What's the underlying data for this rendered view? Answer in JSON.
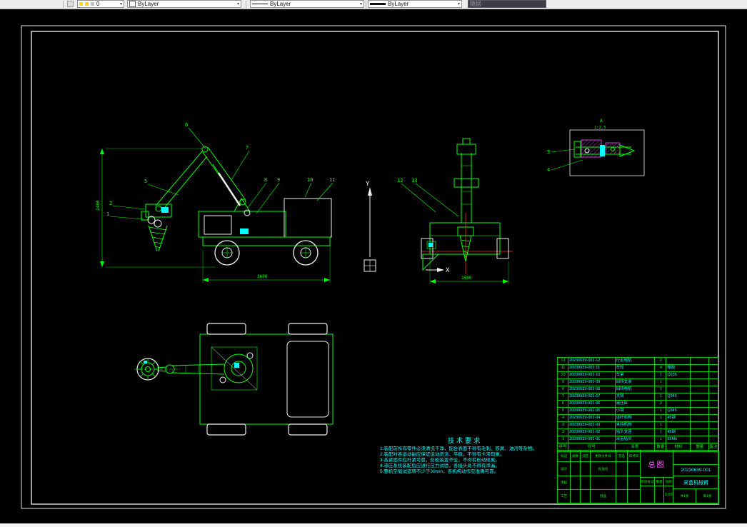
{
  "toolbar": {
    "layer": "0",
    "color": "ByLayer",
    "linetype": "ByLayer",
    "lineweight": "ByLayer",
    "plotstyle": "随层"
  },
  "drawing": {
    "side_callouts": [
      "1",
      "2",
      "5",
      "6",
      "7",
      "8",
      "9",
      "10",
      "11"
    ],
    "front_callouts": [
      "12",
      "13"
    ],
    "detail_callouts": [
      "3",
      "4"
    ],
    "detail_label": "A",
    "detail_scale": "1:2.5",
    "dims": {
      "side_height": "2400",
      "side_length": "3600",
      "front_width": "1500"
    },
    "ucs": {
      "x": "X",
      "y": "Y"
    }
  },
  "tech_notes": {
    "title": "技术要求",
    "lines": [
      "1.装配前所有零件必须清洗干净，配合表面不得有毛刺、铁屑、油污等杂物。",
      "2.装配时各运动副应保证运动灵活、平稳，不得有卡滞现象。",
      "3.各紧固件应拧紧可靠，防松装置齐全，不得有松动现象。",
      "4.液压系统装配后应进行压力试验，各接头处不得有渗漏。",
      "5.整机空载试运转不少于30min，各机构动作应准确可靠。"
    ]
  },
  "bom": {
    "headers": {
      "idx": "序号",
      "code": "代号",
      "name": "名称",
      "qty": "数量",
      "material": "材料",
      "weight": "重量",
      "note": "备注"
    },
    "rows": [
      {
        "idx": "12",
        "code": "20230639-001-12",
        "name": "行走电机",
        "qty": "2",
        "material": "",
        "weight": "",
        "note": ""
      },
      {
        "idx": "11",
        "code": "20230639-001-11",
        "name": "车轮",
        "qty": "4",
        "material": "橡胶",
        "weight": "",
        "note": ""
      },
      {
        "idx": "10",
        "code": "20230639-001-10",
        "name": "车架",
        "qty": "1",
        "material": "Q235",
        "weight": "",
        "note": ""
      },
      {
        "idx": "9",
        "code": "20230639-001-09",
        "name": "回转支承",
        "qty": "1",
        "material": "",
        "weight": "",
        "note": ""
      },
      {
        "idx": "8",
        "code": "20230639-001-08",
        "name": "回转电机",
        "qty": "1",
        "material": "",
        "weight": "",
        "note": ""
      },
      {
        "idx": "7",
        "code": "20230639-001-07",
        "name": "大臂",
        "qty": "1",
        "material": "Q345",
        "weight": "",
        "note": ""
      },
      {
        "idx": "6",
        "code": "20230639-001-06",
        "name": "液压缸",
        "qty": "2",
        "material": "",
        "weight": "",
        "note": ""
      },
      {
        "idx": "5",
        "code": "20230639-001-05",
        "name": "小臂",
        "qty": "1",
        "material": "Q345",
        "weight": "",
        "note": ""
      },
      {
        "idx": "4",
        "code": "20230639-001-04",
        "name": "连杆机构",
        "qty": "1",
        "material": "45钢",
        "weight": "",
        "note": ""
      },
      {
        "idx": "3",
        "code": "20230639-001-03",
        "name": "夹持机构",
        "qty": "1",
        "material": "",
        "weight": "",
        "note": ""
      },
      {
        "idx": "2",
        "code": "20230639-001-02",
        "name": "钻头支座",
        "qty": "1",
        "material": "45钢",
        "weight": "",
        "note": ""
      },
      {
        "idx": "1",
        "code": "20230639-001-01",
        "name": "采苗钻头",
        "qty": "1",
        "material": "65Mn",
        "weight": "",
        "note": ""
      }
    ]
  },
  "title_block": {
    "title": "总图",
    "drawing_no": "20230639-001",
    "product_name": "采苗机械臂",
    "scale": "1:10",
    "sheet_total": "共1张",
    "sheet_no": "第1张",
    "row1": [
      "标记",
      "处数",
      "分区",
      "更改文件号",
      "签名",
      "年月日"
    ],
    "designer": "设计",
    "standard": "标准化",
    "checker": "审核",
    "process": "工艺",
    "approve": "批准",
    "stage_label": "阶段标记",
    "weight_label": "重量",
    "scale_label": "比例"
  }
}
